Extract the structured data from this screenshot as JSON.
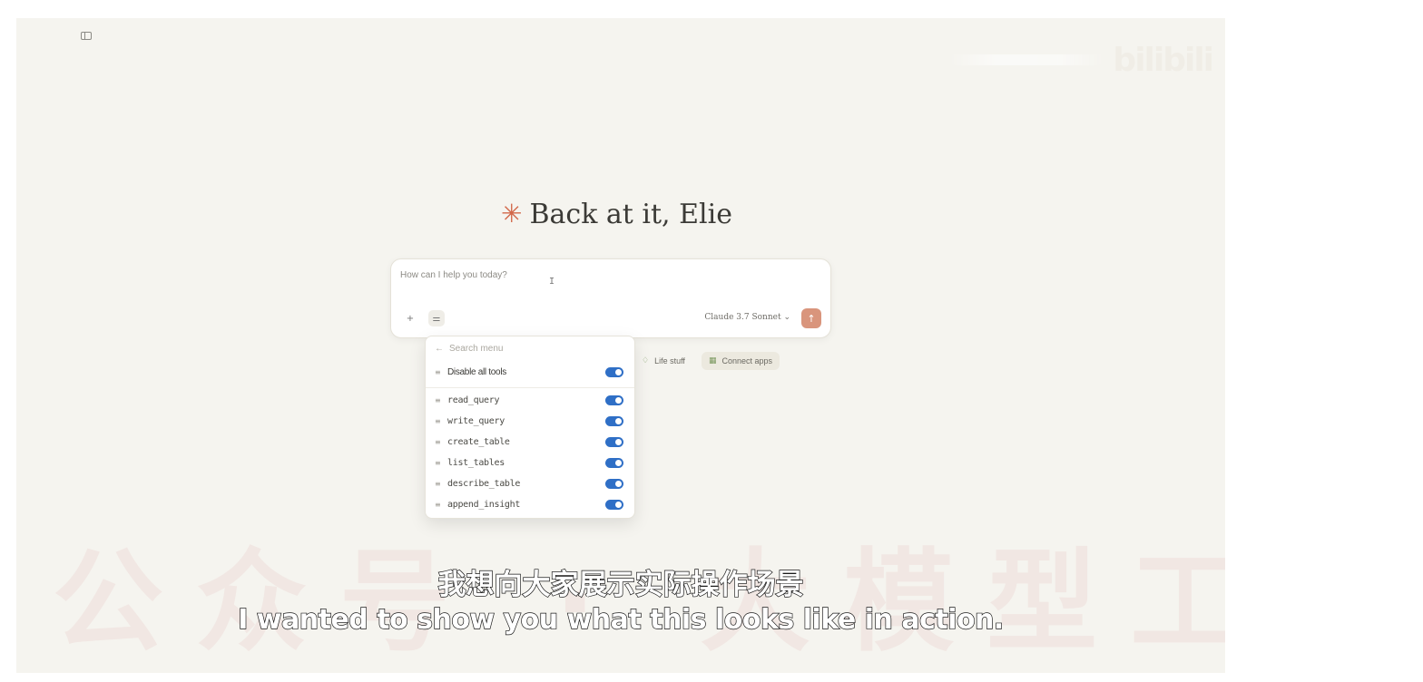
{
  "header": {
    "greeting": "Back at it, Elie",
    "brand_watermark": "bilibili"
  },
  "composer": {
    "placeholder": "How can I help you today?",
    "model": "Claude 3.7 Sonnet",
    "model_chevron": "⌄"
  },
  "chips": [
    {
      "label": "Life stuff",
      "icon": "life-icon"
    },
    {
      "label": "Connect apps",
      "icon": "apps-icon"
    }
  ],
  "tools_menu": {
    "search_placeholder": "Search menu",
    "disable_all_label": "Disable all tools",
    "disable_all_on": true,
    "tools": [
      {
        "name": "read_query",
        "enabled": true
      },
      {
        "name": "write_query",
        "enabled": true
      },
      {
        "name": "create_table",
        "enabled": true
      },
      {
        "name": "list_tables",
        "enabled": true
      },
      {
        "name": "describe_table",
        "enabled": true
      },
      {
        "name": "append_insight",
        "enabled": true
      }
    ]
  },
  "overlay": {
    "watermark": "公众号 · 大模型工坊",
    "subtitle_cn": "我想向大家展示实际操作场景",
    "subtitle_en": "I wanted to show you what this looks like in action."
  },
  "colors": {
    "accent": "#d2684a",
    "toggle_on": "#2f6fc6",
    "background": "#f5f4ef"
  }
}
